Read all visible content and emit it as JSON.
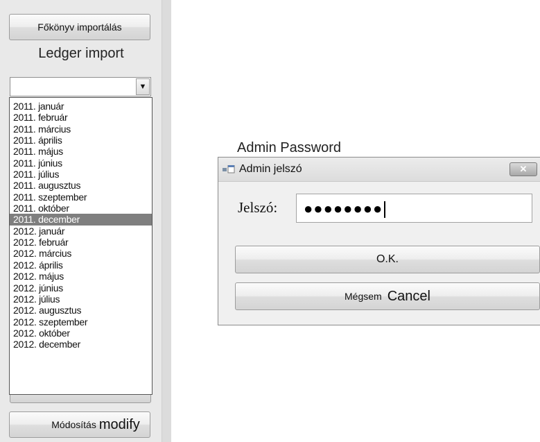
{
  "left_panel": {
    "import_button_label": "Főkönyv importálás",
    "import_caption": "Ledger import",
    "month_select": {
      "value": "",
      "options": [
        "2011. január",
        "2011. február",
        "2011. március",
        "2011. április",
        "2011. május",
        "2011. június",
        "2011. július",
        "2011. augusztus",
        "2011. szeptember",
        "2011. október",
        "2011. december",
        "2012. január",
        "2012. február",
        "2012. március",
        "2012. április",
        "2012. május",
        "2012. június",
        "2012. július",
        "2012. augusztus",
        "2012. szeptember",
        "2012. október",
        "2012. december"
      ],
      "highlighted": "2011. december"
    },
    "modify_button": {
      "label": "Módosítás",
      "caption": "modify"
    }
  },
  "dialog": {
    "caption": "Admin Password",
    "title": "Admin jelszó",
    "close_glyph": "✕",
    "password_label": "Jelszó:",
    "password_value": "●●●●●●●●",
    "ok_button": "O.K.",
    "cancel_button": {
      "label": "Mégsem",
      "caption": "Cancel"
    }
  },
  "icons": {
    "dropdown_arrow": "chevron-down-icon",
    "window_icon": "app-icon",
    "close": "close-icon"
  },
  "colors": {
    "panel_bg": "#e9e9e9",
    "selection_bg": "#7f7f7f",
    "dialog_bg": "#f0f0f0"
  }
}
